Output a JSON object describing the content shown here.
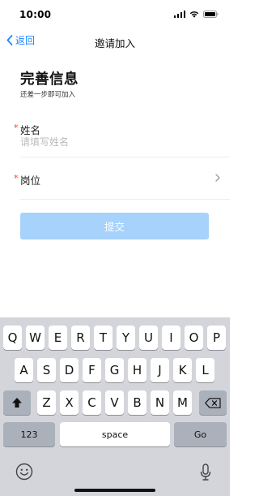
{
  "status_bar": {
    "time": "10:00"
  },
  "nav": {
    "back_label": "返回",
    "title": "邀请加入"
  },
  "form": {
    "heading": "完善信息",
    "subheading": "还差一步即可加入",
    "required_mark": "*",
    "name_label": "姓名",
    "name_placeholder": "请填写姓名",
    "name_value": "",
    "position_label": "岗位",
    "submit_label": "提交",
    "submit_color": "#a7d2fb"
  },
  "keyboard": {
    "row1": [
      "Q",
      "W",
      "E",
      "R",
      "T",
      "Y",
      "U",
      "I",
      "O",
      "P"
    ],
    "row2": [
      "A",
      "S",
      "D",
      "F",
      "G",
      "H",
      "J",
      "K",
      "L"
    ],
    "row3": [
      "Z",
      "X",
      "C",
      "V",
      "B",
      "N",
      "M"
    ],
    "numbers_label": "123",
    "space_label": "space",
    "go_label": "Go",
    "shift_icon": "shift-icon",
    "delete_icon": "delete-icon",
    "emoji_icon": "emoji-icon",
    "mic_icon": "microphone-icon"
  },
  "colors": {
    "accent": "#1f87ff",
    "required": "#ff3b30",
    "keyboard_bg": "#d3d5db"
  }
}
